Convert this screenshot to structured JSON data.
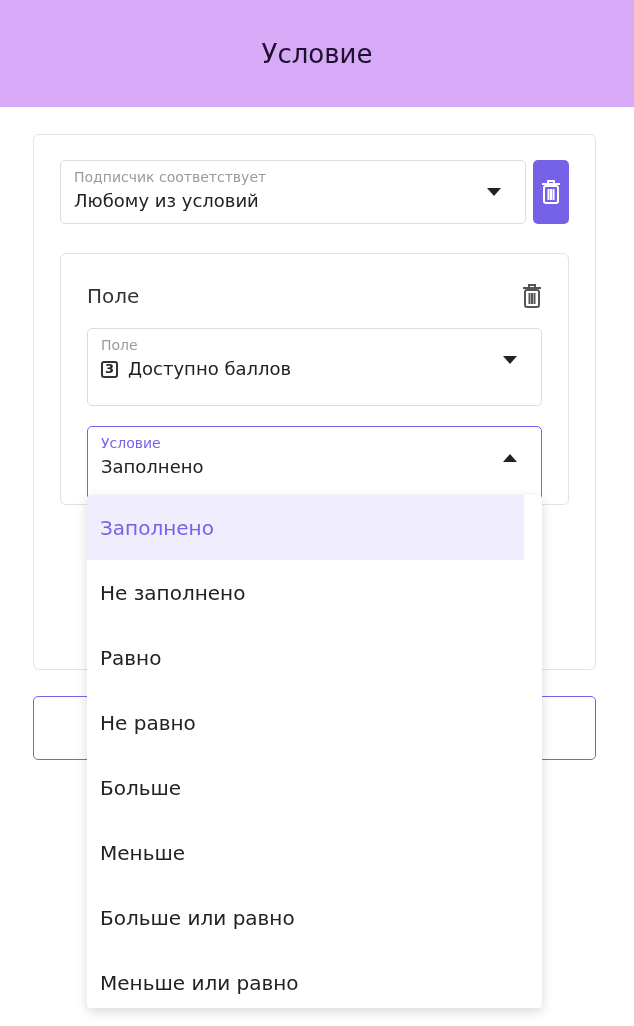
{
  "header": {
    "title": "Условие"
  },
  "match_select": {
    "label": "Подписчик соответствует",
    "value": "Любому из условий",
    "open": false
  },
  "condition_card": {
    "title": "Поле",
    "field_select": {
      "label": "Поле",
      "type_badge": "3",
      "value": "Доступно баллов",
      "open": false
    },
    "condition_select": {
      "label": "Условие",
      "value": "Заполнено",
      "open": true,
      "options": [
        {
          "label": "Заполнено",
          "selected": true
        },
        {
          "label": "Не заполнено",
          "selected": false
        },
        {
          "label": "Равно",
          "selected": false
        },
        {
          "label": "Не равно",
          "selected": false
        },
        {
          "label": "Больше",
          "selected": false
        },
        {
          "label": "Меньше",
          "selected": false
        },
        {
          "label": "Больше или равно",
          "selected": false
        },
        {
          "label": "Меньше или равно",
          "selected": false
        }
      ]
    }
  }
}
